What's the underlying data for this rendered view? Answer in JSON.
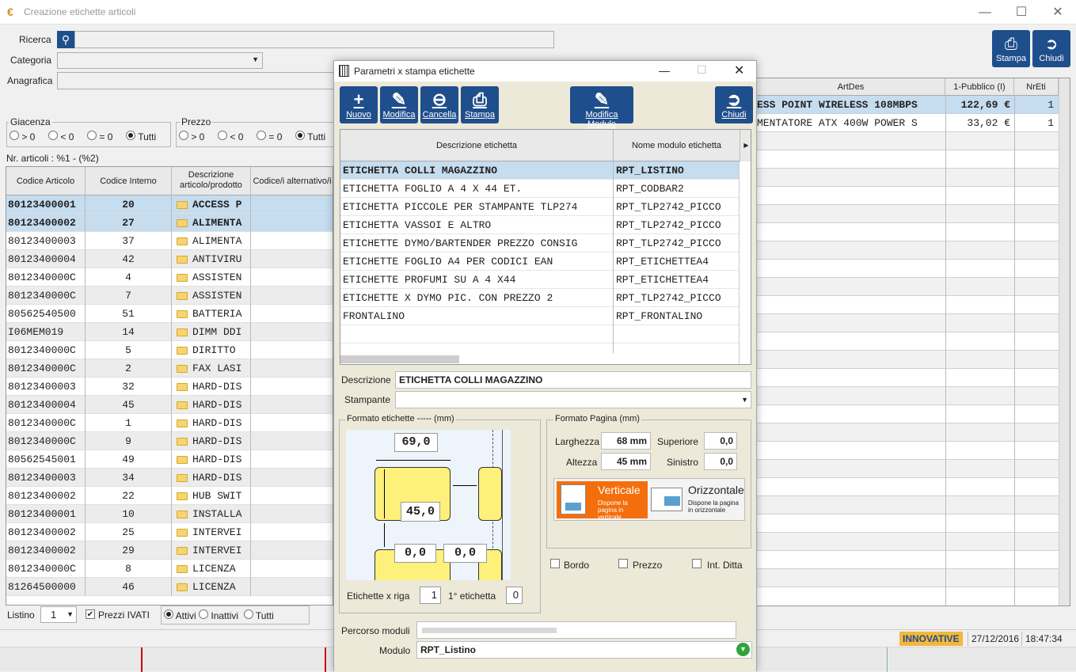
{
  "window": {
    "title": "Creazione etichette articoli"
  },
  "search": {
    "ricerca_label": "Ricerca",
    "categoria_label": "Categoria",
    "anagrafica_label": "Anagrafica"
  },
  "toolbar": {
    "stampa": "Stampa",
    "chiudi": "Chiudi"
  },
  "giacenza": {
    "title": "Giacenza",
    "opts": [
      "> 0",
      "< 0",
      "= 0",
      "Tutti"
    ]
  },
  "prezzo": {
    "title": "Prezzo",
    "opts": [
      "> 0",
      "< 0",
      "= 0",
      "Tutti"
    ]
  },
  "count_label": "Nr. articoli : %1 - (%2)",
  "main_grid": {
    "headers": [
      "Codice Articolo",
      "Codice Interno",
      "Descrizione articolo/prodotto",
      "Codice/i alternativo/i"
    ],
    "rows": [
      [
        "80123400001",
        "20",
        "ACCESS P"
      ],
      [
        "80123400002",
        "27",
        "ALIMENTA"
      ],
      [
        "80123400003",
        "37",
        "ALIMENTA"
      ],
      [
        "80123400004",
        "42",
        "ANTIVIRU"
      ],
      [
        "8012340000C",
        "4",
        "ASSISTEN"
      ],
      [
        "8012340000C",
        "7",
        "ASSISTEN"
      ],
      [
        "80562540500",
        "51",
        "BATTERIA"
      ],
      [
        "I06MEM019",
        "14",
        "DIMM DDI"
      ],
      [
        "8012340000C",
        "5",
        "DIRITTO"
      ],
      [
        "8012340000C",
        "2",
        "FAX LASI"
      ],
      [
        "80123400003",
        "32",
        "HARD-DIS"
      ],
      [
        "80123400004",
        "45",
        "HARD-DIS"
      ],
      [
        "8012340000C",
        "1",
        "HARD-DIS"
      ],
      [
        "8012340000C",
        "9",
        "HARD-DIS"
      ],
      [
        "80562545001",
        "49",
        "HARD-DIS"
      ],
      [
        "80123400003",
        "34",
        "HARD-DIS"
      ],
      [
        "80123400002",
        "22",
        "HUB SWIT"
      ],
      [
        "80123400001",
        "10",
        "INSTALLA"
      ],
      [
        "80123400002",
        "25",
        "INTERVEI"
      ],
      [
        "80123400002",
        "29",
        "INTERVEI"
      ],
      [
        "8012340000C",
        "8",
        "LICENZA"
      ],
      [
        "81264500000",
        "46",
        "LICENZA"
      ]
    ]
  },
  "right_grid": {
    "headers": [
      "ArtDes",
      "1-Pubblico (I)",
      "NrEti"
    ],
    "rows": [
      [
        "ESS POINT WIRELESS 108MBPS",
        "122,69 €",
        "1"
      ],
      [
        "MENTATORE ATX 400W POWER S",
        "33,02 €",
        "1"
      ]
    ]
  },
  "bottom": {
    "listino_label": "Listino",
    "listino_value": "1",
    "prezzi_ivati": "Prezzi IVATI",
    "attivi": "Attivi",
    "inattivi": "Inattivi",
    "tutti": "Tutti"
  },
  "status": {
    "brand": "INNOVATIVE",
    "date": "27/12/2016",
    "time": "18:47:34"
  },
  "dialog": {
    "title": "Parametri x stampa etichette",
    "buttons": {
      "nuovo": "Nuovo",
      "modifica": "Modifica",
      "cancella": "Cancella",
      "stampa": "Stampa",
      "modifica_modulo": "Modifica Modulo",
      "chiudi": "Chiudi"
    },
    "grid_headers": [
      "Descrizione etichetta",
      "Nome modulo etichetta"
    ],
    "rows": [
      [
        "ETICHETTA COLLI MAGAZZINO",
        "RPT_LISTINO"
      ],
      [
        "ETICHETTA FOGLIO A 4 X 44 ET.",
        "RPT_CODBAR2"
      ],
      [
        "ETICHETTA PICCOLE PER STAMPANTE TLP274",
        "RPT_TLP2742_PICCO"
      ],
      [
        "ETICHETTA VASSOI E ALTRO",
        "RPT_TLP2742_PICCO"
      ],
      [
        "ETICHETTE DYMO/BARTENDER PREZZO CONSIG",
        "RPT_TLP2742_PICCO"
      ],
      [
        "ETICHETTE FOGLIO A4 PER CODICI EAN",
        "RPT_ETICHETTEA4"
      ],
      [
        "ETICHETTE PROFUMI SU A 4 X44",
        "RPT_ETICHETTEA4"
      ],
      [
        "ETICHETTE X DYMO PIC. CON PREZZO 2",
        "RPT_TLP2742_PICCO"
      ],
      [
        "FRONTALINO",
        "RPT_FRONTALINO"
      ]
    ],
    "descrizione_label": "Descrizione",
    "descrizione_value": "ETICHETTA COLLI MAGAZZINO",
    "stampante_label": "Stampante",
    "formato_etichette_title": "Formato etichette ----- (mm)",
    "larghezza_et": "69,0",
    "altezza_et": "45,0",
    "gap_v": "0,0",
    "gap_h": "0,0",
    "etichette_riga_label": "Etichette x riga",
    "etichette_riga_value": "1",
    "prima_etichetta_label": "1° etichetta",
    "prima_etichetta_value": "0",
    "formato_pagina_title": "Formato Pagina (mm)",
    "larghezza_label": "Larghezza",
    "larghezza_value": "68 mm",
    "altezza_label": "Altezza",
    "altezza_value": "45 mm",
    "superiore_label": "Superiore",
    "superiore_value": "0,0",
    "sinistro_label": "Sinistro",
    "sinistro_value": "0,0",
    "verticale": "Verticale",
    "verticale_sub": "Dispone la pagina in verticale",
    "orizzontale": "Orizzontale",
    "orizzontale_sub": "Dispone la pagina in orizzontale",
    "bordo": "Bordo",
    "prezzo": "Prezzo",
    "int_ditta": "Int. Ditta",
    "percorso_label": "Percorso moduli",
    "modulo_label": "Modulo",
    "modulo_value": "RPT_Listino"
  }
}
